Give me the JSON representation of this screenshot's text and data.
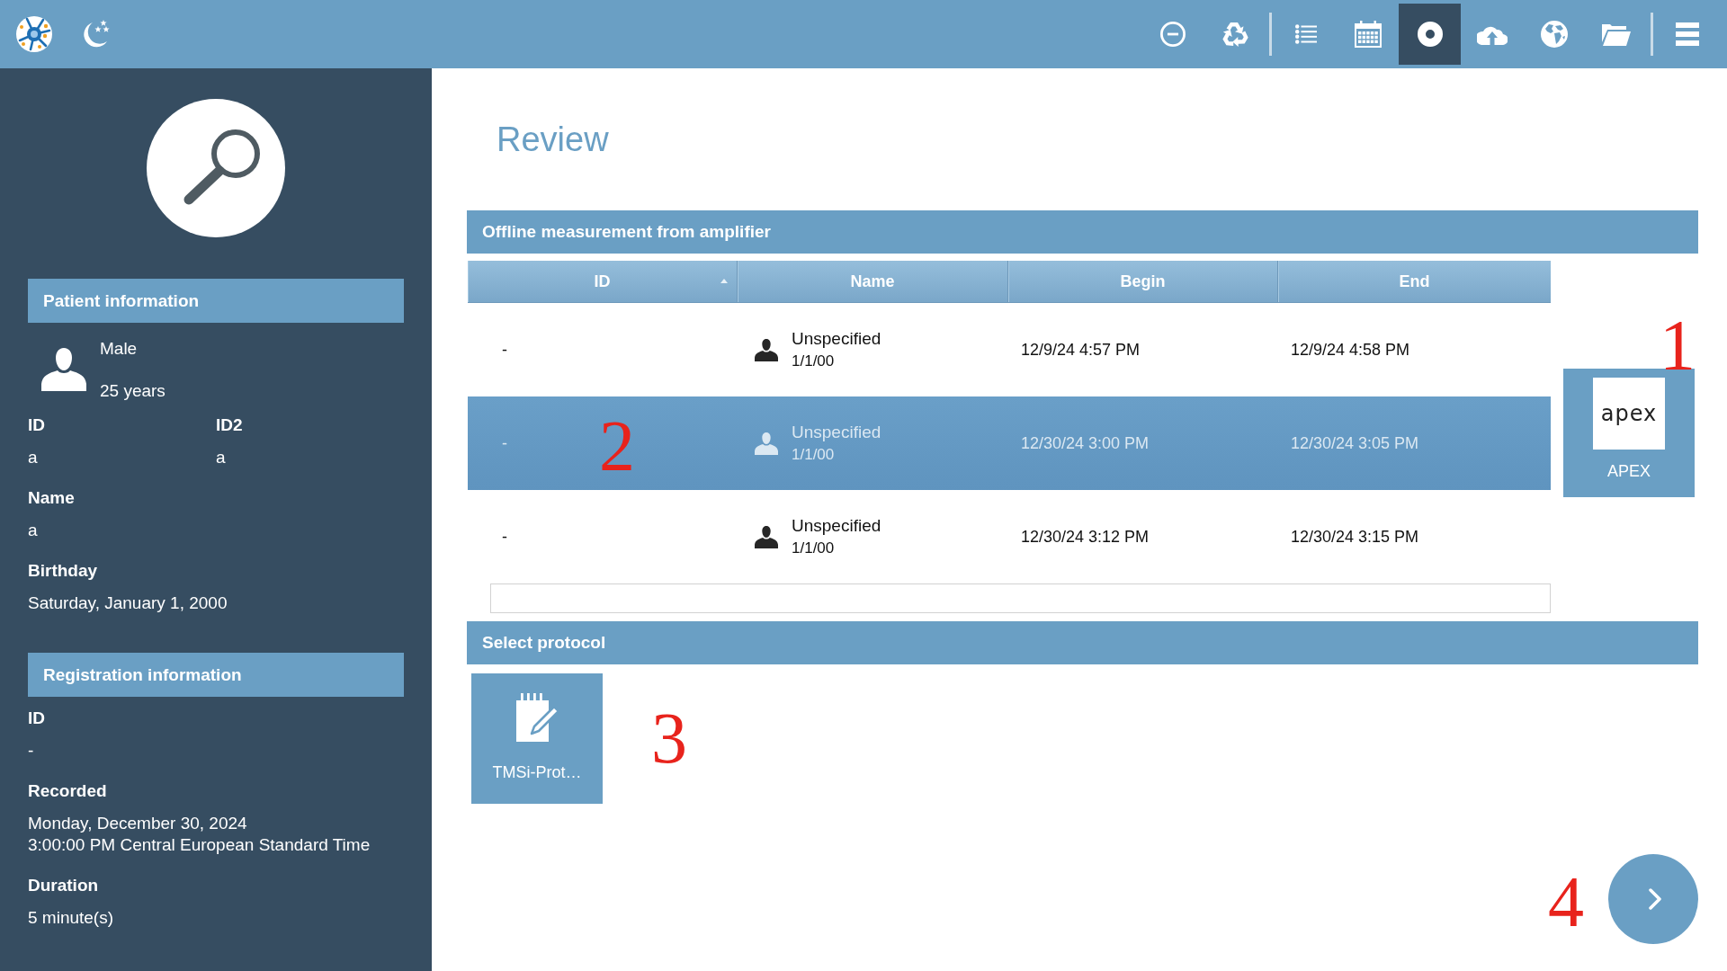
{
  "toolbar": {
    "groups": [
      {
        "buttons": [
          {
            "selected": false
          },
          {
            "selected": false
          }
        ]
      },
      {
        "buttons": [
          {
            "selected": false
          },
          {
            "selected": false
          },
          {
            "selected": true
          },
          {
            "selected": false
          },
          {
            "selected": false
          },
          {
            "selected": false
          }
        ]
      },
      {
        "buttons": [
          {
            "selected": false
          }
        ]
      }
    ]
  },
  "sidebar": {
    "patient": {
      "title": "Patient information",
      "gender": "Male",
      "age": "25 years",
      "id_fields": [
        {
          "label": "ID",
          "value": "a"
        },
        {
          "label": "ID2",
          "value": "a"
        }
      ],
      "fields": [
        {
          "label": "Name",
          "value": "a"
        },
        {
          "label": "Birthday",
          "value": "Saturday, January 1, 2000"
        }
      ]
    },
    "registration": {
      "title": "Registration information",
      "fields": [
        {
          "label": "ID",
          "value": "-"
        },
        {
          "label": "Recorded",
          "value": "Monday, December 30, 2024\n3:00:00 PM Central European Standard Time"
        },
        {
          "label": "Duration",
          "value": "5 minute(s)"
        }
      ]
    }
  },
  "page_title": "Review",
  "measurements": {
    "title": "Offline measurement from amplifier",
    "columns": [
      {
        "label": "ID",
        "sorted": true
      },
      {
        "label": "Name",
        "sorted": false
      },
      {
        "label": "Begin",
        "sorted": false
      },
      {
        "label": "End",
        "sorted": false
      }
    ],
    "rows": [
      {
        "id": "-",
        "name": "Unspecified",
        "date": "1/1/00",
        "begin": "12/9/24 4:57 PM",
        "end": "12/9/24 4:58 PM",
        "selected": false
      },
      {
        "id": "-",
        "name": "Unspecified",
        "date": "1/1/00",
        "begin": "12/30/24 3:00 PM",
        "end": "12/30/24 3:05 PM",
        "selected": true,
        "annotation": "2"
      },
      {
        "id": "-",
        "name": "Unspecified",
        "date": "1/1/00",
        "begin": "12/30/24 3:12 PM",
        "end": "12/30/24 3:15 PM",
        "selected": false
      }
    ],
    "devices": [
      {
        "logo": "apex",
        "label": "APEX",
        "annotation": "1"
      }
    ]
  },
  "protocols": {
    "title": "Select protocol",
    "items": [
      {
        "label": "TMSi-Prot…",
        "annotation": "3"
      }
    ]
  },
  "next_button": {
    "annotation": "4"
  }
}
